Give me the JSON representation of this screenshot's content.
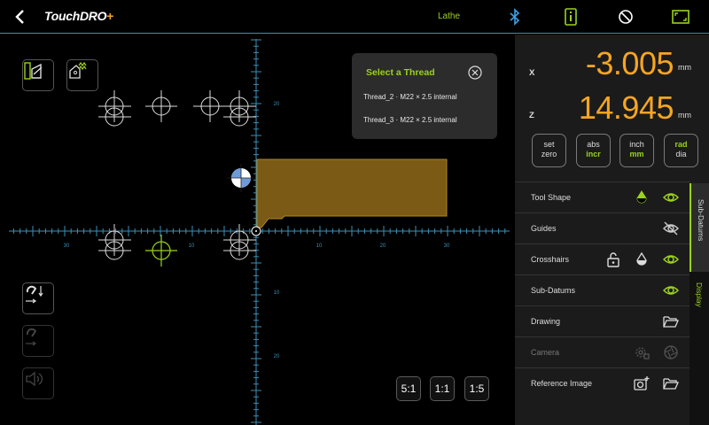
{
  "app": {
    "logo_text": "TouchDRO",
    "logo_plus": "+",
    "mode": "Lathe"
  },
  "colors": {
    "accent": "#9bd21e",
    "readout": "#f5a623",
    "grid": "#3a8fb7",
    "stock": "#7a5a14"
  },
  "thread_popup": {
    "title": "Select a Thread",
    "options": [
      "Thread_2 · M22 × 2.5 internal",
      "Thread_3 · M22 × 2.5 internal"
    ]
  },
  "axes": {
    "x_ticks": [
      "30",
      "10",
      "10",
      "20",
      "30"
    ],
    "z_ticks": [
      "20",
      "10",
      "10",
      "20"
    ]
  },
  "zoom": [
    "5:1",
    "1:1",
    "1:5"
  ],
  "readout": {
    "x_label": "X",
    "x_value": "-3.005",
    "x_unit": "mm",
    "z_label": "Z",
    "z_value": "14.945",
    "z_unit": "mm"
  },
  "controls": {
    "set_zero": [
      "set",
      "zero"
    ],
    "abs_incr": [
      "abs",
      "incr"
    ],
    "inch_mm": [
      "inch",
      "mm"
    ],
    "rad_dia": [
      "rad",
      "dia"
    ]
  },
  "display_rows": [
    {
      "label": "Tool Shape"
    },
    {
      "label": "Guides"
    },
    {
      "label": "Crosshairs"
    },
    {
      "label": "Sub-Datums"
    },
    {
      "label": "Drawing"
    },
    {
      "label": "Camera"
    },
    {
      "label": "Reference Image"
    }
  ],
  "side_tabs": [
    "Sub-Datums",
    "Display"
  ],
  "icons": {
    "back": "back-arrow-icon",
    "bluetooth": "bluetooth-icon",
    "info": "info-icon",
    "no-pointer": "pointer-off-icon",
    "fullscreen": "fullscreen-icon"
  }
}
